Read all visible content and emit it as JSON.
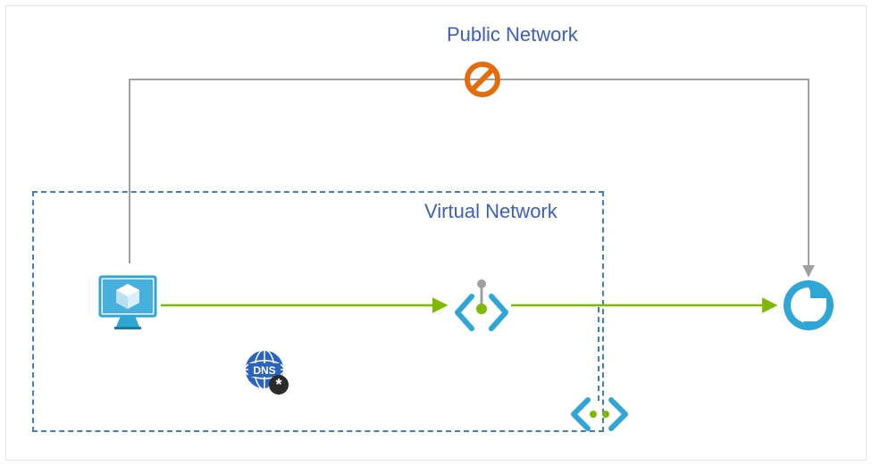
{
  "labels": {
    "public_network": "Public Network",
    "virtual_network": "Virtual Network"
  },
  "icons": {
    "vm": "vm-icon",
    "dns": "private-dns-icon",
    "private_endpoint": "private-endpoint-icon",
    "vnet_peering": "vnet-peering-icon",
    "service": "relay-service-icon",
    "block": "block-icon"
  },
  "colors": {
    "azure_blue": "#2ea6d6",
    "connector_green": "#7fba00",
    "connector_gray": "#9ea0a2",
    "dashed_blue": "#3e7fc1",
    "label_blue": "#3b5fc0",
    "block_orange": "#e46c0a",
    "dns_blue": "#2b63c1"
  }
}
